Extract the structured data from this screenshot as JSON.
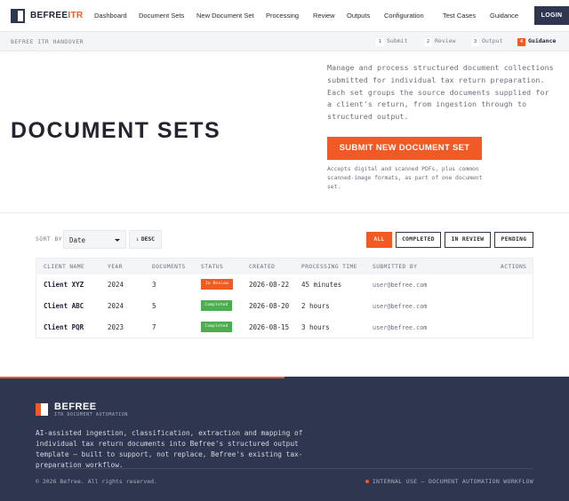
{
  "nav": {
    "brand_main": "BEFREE",
    "brand_accent": "ITR",
    "links": [
      "Dashboard",
      "Document Sets",
      "New Document Set",
      "Processing",
      "Review",
      "Outputs",
      "Configuration",
      "Test Cases",
      "Guidance"
    ],
    "login_label": "LOGIN"
  },
  "subbar": {
    "title": "BEFREE ITR HANDOVER",
    "steps": [
      {
        "num": "1",
        "label": "Submit"
      },
      {
        "num": "2",
        "label": "Review"
      },
      {
        "num": "3",
        "label": "Output"
      },
      {
        "num": "4",
        "label": "Guidance"
      }
    ],
    "active_step": "Guidance"
  },
  "hero": {
    "title": "DOCUMENT SETS",
    "description": "Manage and process structured document collections submitted for individual tax return preparation. Each set groups the source documents supplied for a client's return, from ingestion through to structured output.",
    "cta_label": "SUBMIT NEW DOCUMENT SET",
    "cta_note": "Accepts digital and scanned PDFs, plus common scanned-image formats, as part of one document set."
  },
  "filters": {
    "sort_label": "SORT BY",
    "sort_value": "Date",
    "order_arrow": "↓",
    "order_label": "DESC",
    "buttons": [
      "ALL",
      "COMPLETED",
      "IN REVIEW",
      "PENDING"
    ],
    "active_filter": "ALL"
  },
  "table": {
    "columns": [
      "CLIENT NAME",
      "YEAR",
      "DOCUMENTS",
      "STATUS",
      "CREATED",
      "PROCESSING TIME",
      "SUBMITTED BY",
      "ACTIONS"
    ],
    "rows": [
      {
        "client": "Client XYZ",
        "year": "2024",
        "documents": "3",
        "status": "In Review",
        "created": "2026-08-22",
        "time": "45 minutes",
        "submitted_by": "user@befree.com"
      },
      {
        "client": "Client ABC",
        "year": "2024",
        "documents": "5",
        "status": "Completed",
        "created": "2026-08-20",
        "time": "2 hours",
        "submitted_by": "user@befree.com"
      },
      {
        "client": "Client PQR",
        "year": "2023",
        "documents": "7",
        "status": "Completed",
        "created": "2026-08-15",
        "time": "3 hours",
        "submitted_by": "user@befree.com"
      }
    ]
  },
  "footer": {
    "brand": "BEFREE",
    "tagline": "ITR DOCUMENT AUTOMATION",
    "description": "AI-assisted ingestion, classification, extraction and mapping of individual tax return documents into Befree's structured output template — built to support, not replace, Befree's existing tax-preparation workflow.",
    "copyright": "© 2026 Befree. All rights reserved.",
    "internal_note": "INTERNAL USE — DOCUMENT AUTOMATION WORKFLOW"
  },
  "colors": {
    "accent": "#f15a24",
    "navy": "#2f3650",
    "completed": "#4bae4f"
  }
}
